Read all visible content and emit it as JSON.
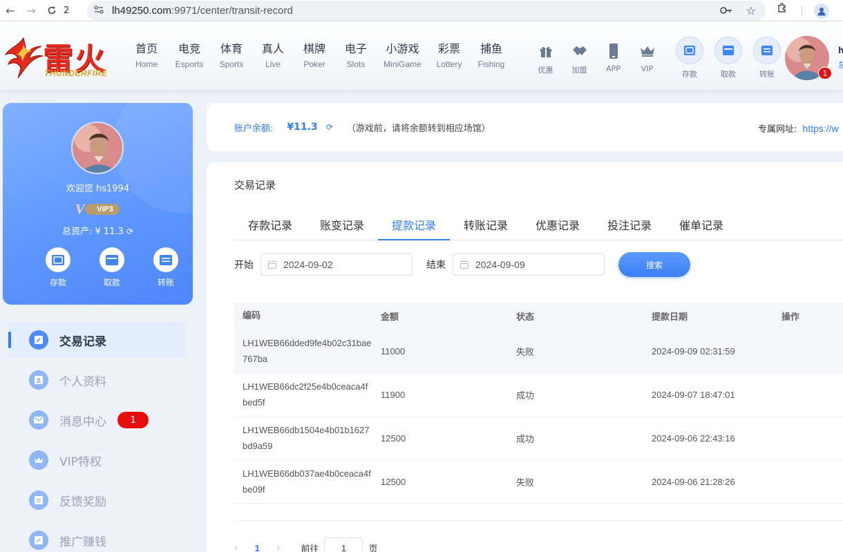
{
  "browser": {
    "tab_count": "2",
    "url_host": "lh49250.com",
    "url_path": ":9971/center/transit-record"
  },
  "header": {
    "logo_text": "雷火",
    "logo_sub": "THUNDERFIRE",
    "nav": [
      {
        "zh": "首页",
        "en": "Home"
      },
      {
        "zh": "电竞",
        "en": "Esports"
      },
      {
        "zh": "体育",
        "en": "Sports"
      },
      {
        "zh": "真人",
        "en": "Live"
      },
      {
        "zh": "棋牌",
        "en": "Poker"
      },
      {
        "zh": "电子",
        "en": "Slots"
      },
      {
        "zh": "小游戏",
        "en": "MiniGame"
      },
      {
        "zh": "彩票",
        "en": "Lottery"
      },
      {
        "zh": "捕鱼",
        "en": "Fishing"
      }
    ],
    "quick": [
      {
        "label": "优惠",
        "icon": "gift-icon"
      },
      {
        "label": "加盟",
        "icon": "handshake-icon"
      },
      {
        "label": "APP",
        "icon": "phone-icon"
      },
      {
        "label": "VIP",
        "icon": "crown-icon"
      }
    ],
    "money": [
      {
        "label": "存款",
        "icon": "deposit-icon"
      },
      {
        "label": "取款",
        "icon": "withdraw-icon"
      },
      {
        "label": "转账",
        "icon": "transfer-icon"
      }
    ],
    "notification_count": "1",
    "user_short": "h",
    "user_short2": "总"
  },
  "profile": {
    "welcome": "欢迎您 hs1994",
    "vip_level": "VIP3",
    "vip_mark": "V",
    "assets_label": "总资产:",
    "assets_value": "¥ 11.3",
    "actions": [
      {
        "label": "存款"
      },
      {
        "label": "取款"
      },
      {
        "label": "转账"
      }
    ]
  },
  "menu": {
    "items": [
      {
        "label": "交易记录",
        "icon": "record-icon"
      },
      {
        "label": "个人资料",
        "icon": "profile-icon"
      },
      {
        "label": "消息中心",
        "icon": "mail-icon",
        "badge": "1"
      },
      {
        "label": "VIP特权",
        "icon": "crown-icon"
      },
      {
        "label": "反馈奖励",
        "icon": "feedback-icon"
      },
      {
        "label": "推广赚钱",
        "icon": "promo-icon"
      }
    ]
  },
  "balance": {
    "label": "账户余额:",
    "amount": "¥11.3",
    "hint": "（游戏前，请将余额转到相应场馆）",
    "domain_label": "专属网址:",
    "domain_link": "https://w"
  },
  "panel": {
    "title": "交易记录",
    "tabs": [
      "存款记录",
      "账变记录",
      "提款记录",
      "转账记录",
      "优惠记录",
      "投注记录",
      "催单记录"
    ],
    "active_tab": 2,
    "filter": {
      "start_label": "开始",
      "start_value": "2024-09-02",
      "end_label": "结束",
      "end_value": "2024-09-09",
      "search_label": "搜索"
    },
    "table": {
      "headers": [
        "编码",
        "金额",
        "状态",
        "提款日期",
        "操作"
      ],
      "rows": [
        {
          "code": "LH1WEB66dded9fe4b02c31bae767ba",
          "amount": "11000",
          "status": "失败",
          "date": "2024-09-09 02:31:59"
        },
        {
          "code": "LH1WEB66dc2f25e4b0ceaca4fbed5f",
          "amount": "11900",
          "status": "成功",
          "date": "2024-09-07 18:47:01"
        },
        {
          "code": "LH1WEB66db1504e4b01b1627bd9a59",
          "amount": "12500",
          "status": "成功",
          "date": "2024-09-06 22:43:16"
        },
        {
          "code": "LH1WEB66db037ae4b0ceaca4fbe09f",
          "amount": "12500",
          "status": "失败",
          "date": "2024-09-06 21:28:26"
        }
      ]
    },
    "pager": {
      "prev": "‹",
      "current": "1",
      "next": "›",
      "goto_label": "前往",
      "goto_value": "1",
      "page_suffix": "页"
    }
  },
  "colors": {
    "accent": "#2f7ff0",
    "badge": "#e80d0d",
    "logo": "#e52a1e"
  }
}
